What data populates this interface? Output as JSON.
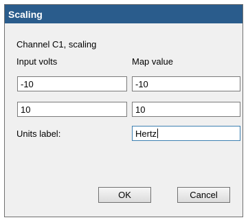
{
  "dialog": {
    "title": "Scaling",
    "channel_label": "Channel C1, scaling",
    "columns": {
      "input": "Input volts",
      "map": "Map value"
    },
    "rows": [
      {
        "input": "-10",
        "map": "-10"
      },
      {
        "input": "10",
        "map": "10"
      }
    ],
    "units_label": "Units label:",
    "units_value": "Hertz",
    "ok_label": "OK",
    "cancel_label": "Cancel"
  },
  "colors": {
    "title_bar": "#2a5c8c",
    "dialog_bg": "#f0f0f0"
  }
}
